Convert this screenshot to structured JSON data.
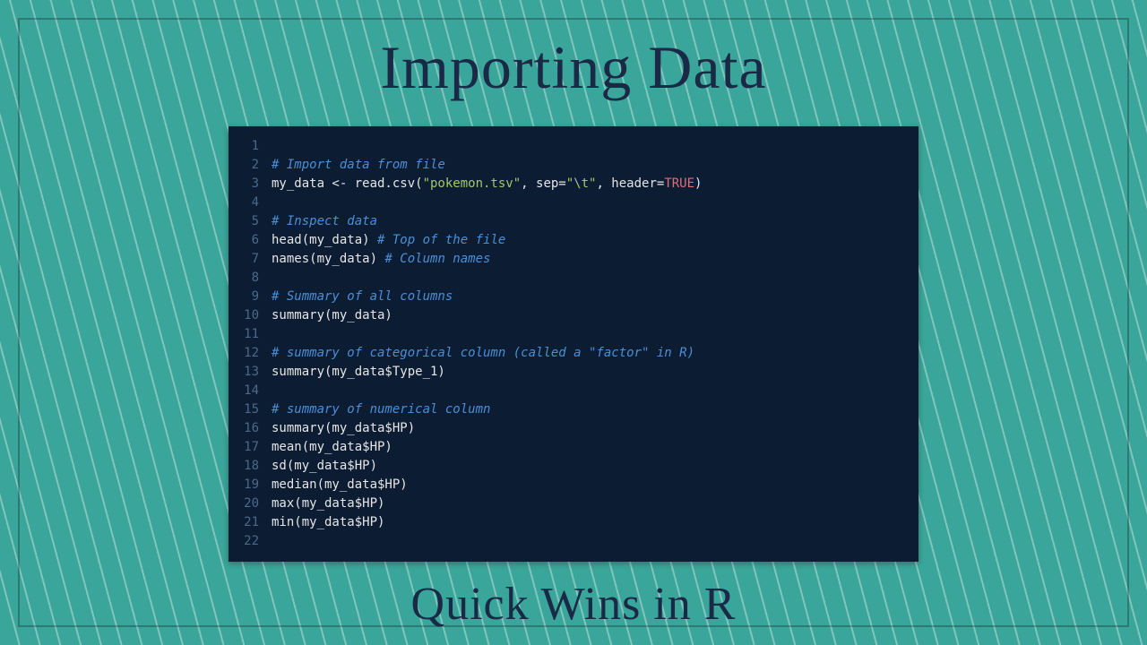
{
  "title": "Importing Data",
  "subtitle": "Quick Wins in R",
  "code": {
    "lines": [
      {
        "n": 1,
        "tokens": []
      },
      {
        "n": 2,
        "tokens": [
          {
            "cls": "tok-comment",
            "t": "# Import data from file"
          }
        ]
      },
      {
        "n": 3,
        "tokens": [
          {
            "cls": "tok-default",
            "t": "my_data <- read.csv("
          },
          {
            "cls": "tok-string",
            "t": "\"pokemon.tsv\""
          },
          {
            "cls": "tok-default",
            "t": ", sep="
          },
          {
            "cls": "tok-string",
            "t": "\"\\t\""
          },
          {
            "cls": "tok-default",
            "t": ", header="
          },
          {
            "cls": "tok-keyword",
            "t": "TRUE"
          },
          {
            "cls": "tok-default",
            "t": ")"
          }
        ]
      },
      {
        "n": 4,
        "tokens": []
      },
      {
        "n": 5,
        "tokens": [
          {
            "cls": "tok-comment",
            "t": "# Inspect data"
          }
        ]
      },
      {
        "n": 6,
        "tokens": [
          {
            "cls": "tok-default",
            "t": "head(my_data) "
          },
          {
            "cls": "tok-comment",
            "t": "# Top of the file"
          }
        ]
      },
      {
        "n": 7,
        "tokens": [
          {
            "cls": "tok-default",
            "t": "names(my_data) "
          },
          {
            "cls": "tok-comment",
            "t": "# Column names"
          }
        ]
      },
      {
        "n": 8,
        "tokens": []
      },
      {
        "n": 9,
        "tokens": [
          {
            "cls": "tok-comment",
            "t": "# Summary of all columns"
          }
        ]
      },
      {
        "n": 10,
        "tokens": [
          {
            "cls": "tok-default",
            "t": "summary(my_data)"
          }
        ]
      },
      {
        "n": 11,
        "tokens": []
      },
      {
        "n": 12,
        "tokens": [
          {
            "cls": "tok-comment",
            "t": "# summary of categorical column (called a \"factor\" in R)"
          }
        ]
      },
      {
        "n": 13,
        "tokens": [
          {
            "cls": "tok-default",
            "t": "summary(my_data$Type_1)"
          }
        ]
      },
      {
        "n": 14,
        "tokens": []
      },
      {
        "n": 15,
        "tokens": [
          {
            "cls": "tok-comment",
            "t": "# summary of numerical column"
          }
        ]
      },
      {
        "n": 16,
        "tokens": [
          {
            "cls": "tok-default",
            "t": "summary(my_data$HP)"
          }
        ]
      },
      {
        "n": 17,
        "tokens": [
          {
            "cls": "tok-default",
            "t": "mean(my_data$HP)"
          }
        ]
      },
      {
        "n": 18,
        "tokens": [
          {
            "cls": "tok-default",
            "t": "sd(my_data$HP)"
          }
        ]
      },
      {
        "n": 19,
        "tokens": [
          {
            "cls": "tok-default",
            "t": "median(my_data$HP)"
          }
        ]
      },
      {
        "n": 20,
        "tokens": [
          {
            "cls": "tok-default",
            "t": "max(my_data$HP)"
          }
        ]
      },
      {
        "n": 21,
        "tokens": [
          {
            "cls": "tok-default",
            "t": "min(my_data$HP)"
          }
        ]
      },
      {
        "n": 22,
        "tokens": []
      }
    ]
  }
}
